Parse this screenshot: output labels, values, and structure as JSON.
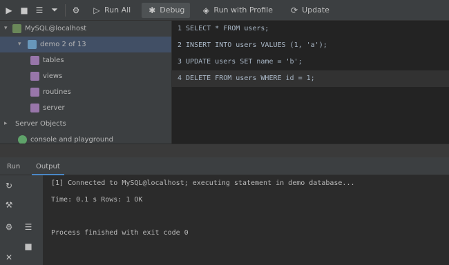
{
  "toolbar": {
    "buttons": [
      {
        "icon": "play-icon",
        "label": ""
      },
      {
        "icon": "stop-icon",
        "label": ""
      },
      {
        "icon": "list-icon",
        "label": ""
      },
      {
        "icon": "filter-icon",
        "label": ""
      },
      {
        "icon": "gear-icon",
        "label": ""
      },
      {
        "icon": "run-icon",
        "label": "Run All"
      },
      {
        "icon": "debug-icon",
        "label": "Debug"
      },
      {
        "icon": "profile-icon",
        "label": "Run with Profile"
      },
      {
        "icon": "update-icon",
        "label": "Update"
      }
    ]
  },
  "tree": {
    "items": [
      {
        "label": "MySQL@localhost",
        "level": 0,
        "arrow": "▾",
        "color": "#6a8759"
      },
      {
        "label": "demo  2 of 13",
        "level": 1,
        "arrow": "▾",
        "color": "#6897bb"
      },
      {
        "label": "tables",
        "level": 2,
        "arrow": "",
        "color": "#9876aa"
      },
      {
        "label": "views",
        "level": 2,
        "arrow": "",
        "color": "#9876aa"
      },
      {
        "label": "routines",
        "level": 2,
        "arrow": "",
        "color": "#9876aa"
      },
      {
        "label": "server",
        "level": 2,
        "arrow": "",
        "color": "#9876aa"
      },
      {
        "label": "Server Objects",
        "level": 0,
        "arrow": "▸",
        "color": ""
      },
      {
        "label": "console and playground",
        "level": 0,
        "arrow": "",
        "color": "#5fa36a"
      }
    ]
  },
  "editor": {
    "lines": [
      "1  SELECT * FROM users;",
      "2  INSERT INTO users VALUES (1, 'a');",
      "3  UPDATE users SET name = 'b';",
      "4  DELETE FROM users WHERE id = 1;"
    ]
  },
  "tabs": [
    {
      "label": "Run"
    },
    {
      "label": "Output"
    }
  ],
  "console": {
    "lines": [
      "[1] Connected to MySQL@localhost; executing statement in demo database...",
      "Time: 0.1 s  Rows: 1  OK",
      "",
      "Process finished with exit code 0"
    ]
  }
}
